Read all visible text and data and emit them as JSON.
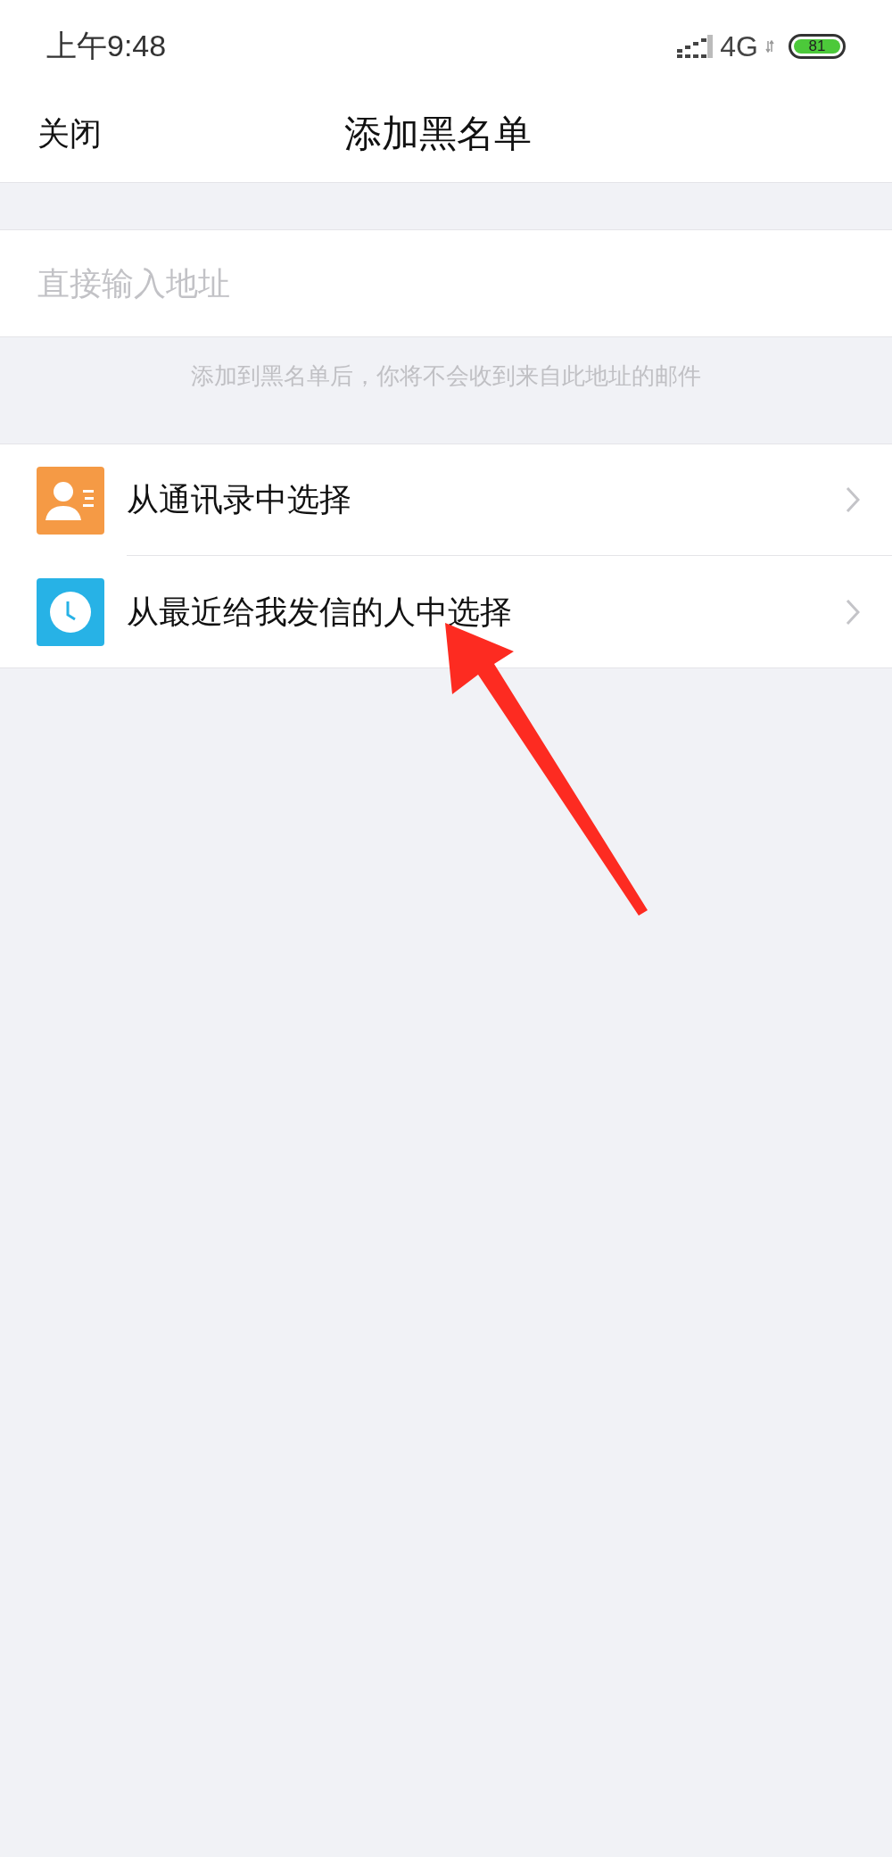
{
  "status_bar": {
    "time": "上午9:48",
    "network": "4G",
    "battery": "81"
  },
  "nav_bar": {
    "close": "关闭",
    "title": "添加黑名单"
  },
  "address_field": {
    "placeholder": "直接输入地址"
  },
  "hint": "添加到黑名单后，你将不会收到来自此地址的邮件",
  "options": [
    {
      "kind": "contacts",
      "label": "从通讯录中选择",
      "color": "#f59a45"
    },
    {
      "kind": "recent",
      "label": "从最近给我发信的人中选择",
      "color": "#27b2e6"
    }
  ],
  "annotation": {
    "kind": "arrow"
  }
}
